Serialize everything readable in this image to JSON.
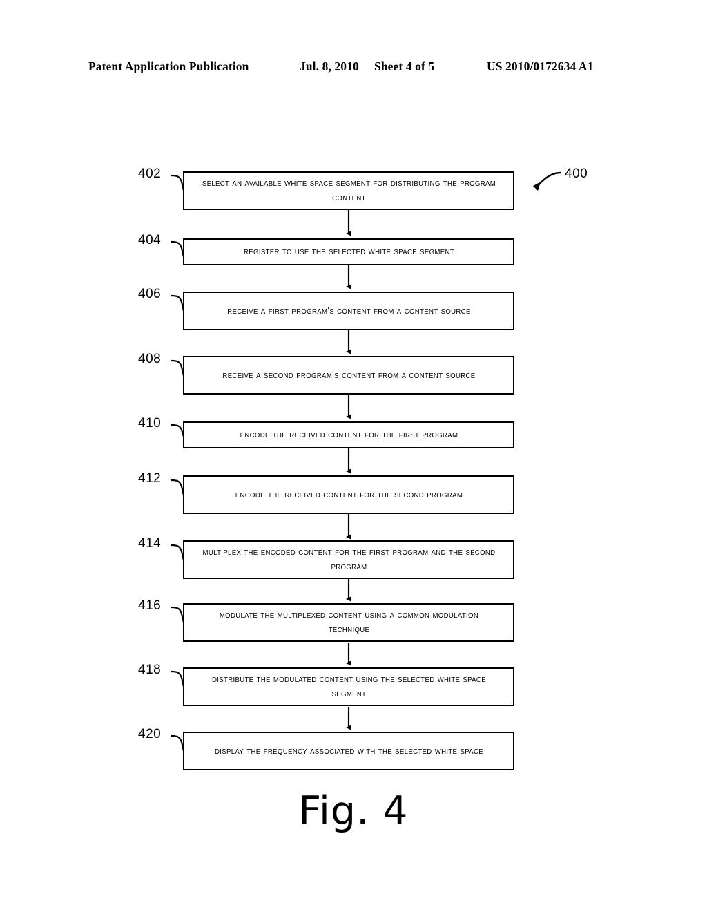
{
  "header": {
    "publication": "Patent Application Publication",
    "date": "Jul. 8, 2010",
    "sheet": "Sheet 4 of 5",
    "patent_number": "US 2010/0172634 A1"
  },
  "figure": {
    "caption": "Fig. 4",
    "diagram_label": "400"
  },
  "flowchart": {
    "steps": [
      {
        "ref": "402",
        "text": "Select An Available White Space Segment for Distributing the Program Content",
        "lines": 2
      },
      {
        "ref": "404",
        "text": "Register To Use the Selected White Space Segment",
        "lines": 1
      },
      {
        "ref": "406",
        "text": "Receive A First Program's Content from A Content Source",
        "lines": 2
      },
      {
        "ref": "408",
        "text": "Receive A Second Program's Content from A Content Source",
        "lines": 2
      },
      {
        "ref": "410",
        "text": "Encode the Received Content for the First Program",
        "lines": 1
      },
      {
        "ref": "412",
        "text": "Encode the Received Content for the Second Program",
        "lines": 2
      },
      {
        "ref": "414",
        "text": "Multiplex the Encoded Content for the First Program and the Second Program",
        "lines": 2
      },
      {
        "ref": "416",
        "text": "Modulate the Multiplexed Content Using A Common Modulation Technique",
        "lines": 2
      },
      {
        "ref": "418",
        "text": "Distribute the Modulated Content Using the Selected White Space Segment",
        "lines": 2
      },
      {
        "ref": "420",
        "text": "Display the Frequency Associated with the Selected White Space",
        "lines": 2
      }
    ]
  }
}
